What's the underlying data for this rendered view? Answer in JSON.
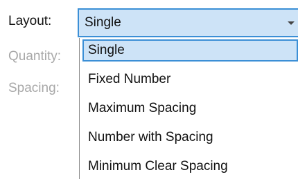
{
  "form": {
    "layout_label": "Layout:",
    "quantity_label": "Quantity:",
    "spacing_label": "Spacing:"
  },
  "layout_select": {
    "selected": "Single",
    "options": [
      "Single",
      "Fixed Number",
      "Maximum Spacing",
      "Number with Spacing",
      "Minimum Clear Spacing"
    ]
  },
  "colors": {
    "selection_fill": "#cde3f7",
    "selection_border": "#3b8fd6",
    "disabled_text": "#a8a8a8"
  }
}
